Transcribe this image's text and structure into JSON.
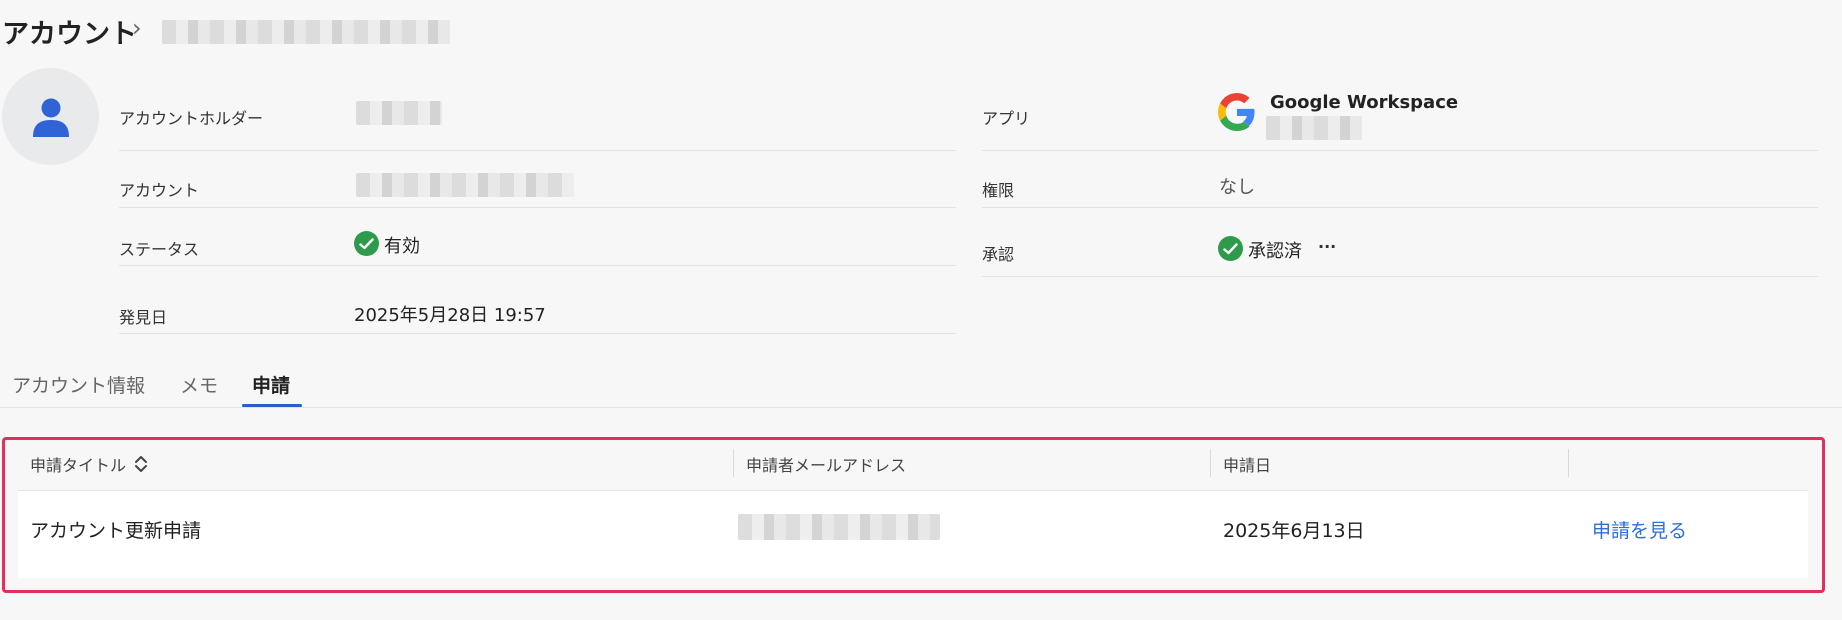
{
  "header": {
    "title": "アカウント",
    "separator": "›"
  },
  "info": {
    "holder_label": "アカウントホルダー",
    "account_label": "アカウント",
    "status_label": "ステータス",
    "status_value": "有効",
    "found_label": "発見日",
    "found_value": "2025年5月28日 19:57",
    "app_label": "アプリ",
    "app_name": "Google Workspace",
    "permission_label": "権限",
    "permission_value": "なし",
    "approval_label": "承認",
    "approval_value": "承認済",
    "approval_more": "···"
  },
  "tabs": [
    {
      "label": "アカウント情報"
    },
    {
      "label": "メモ"
    },
    {
      "label": "申請"
    }
  ],
  "table": {
    "headers": [
      "申請タイトル",
      "申請者メールアドレス",
      "申請日"
    ],
    "rows": [
      {
        "title": "アカウント更新申請",
        "date": "2025年6月13日",
        "action": "申請を見る"
      }
    ]
  },
  "colors": {
    "accent": "#2d5bc9",
    "success": "#2e9a4c",
    "highlight": "#e0315e",
    "link": "#2d6fd6"
  }
}
